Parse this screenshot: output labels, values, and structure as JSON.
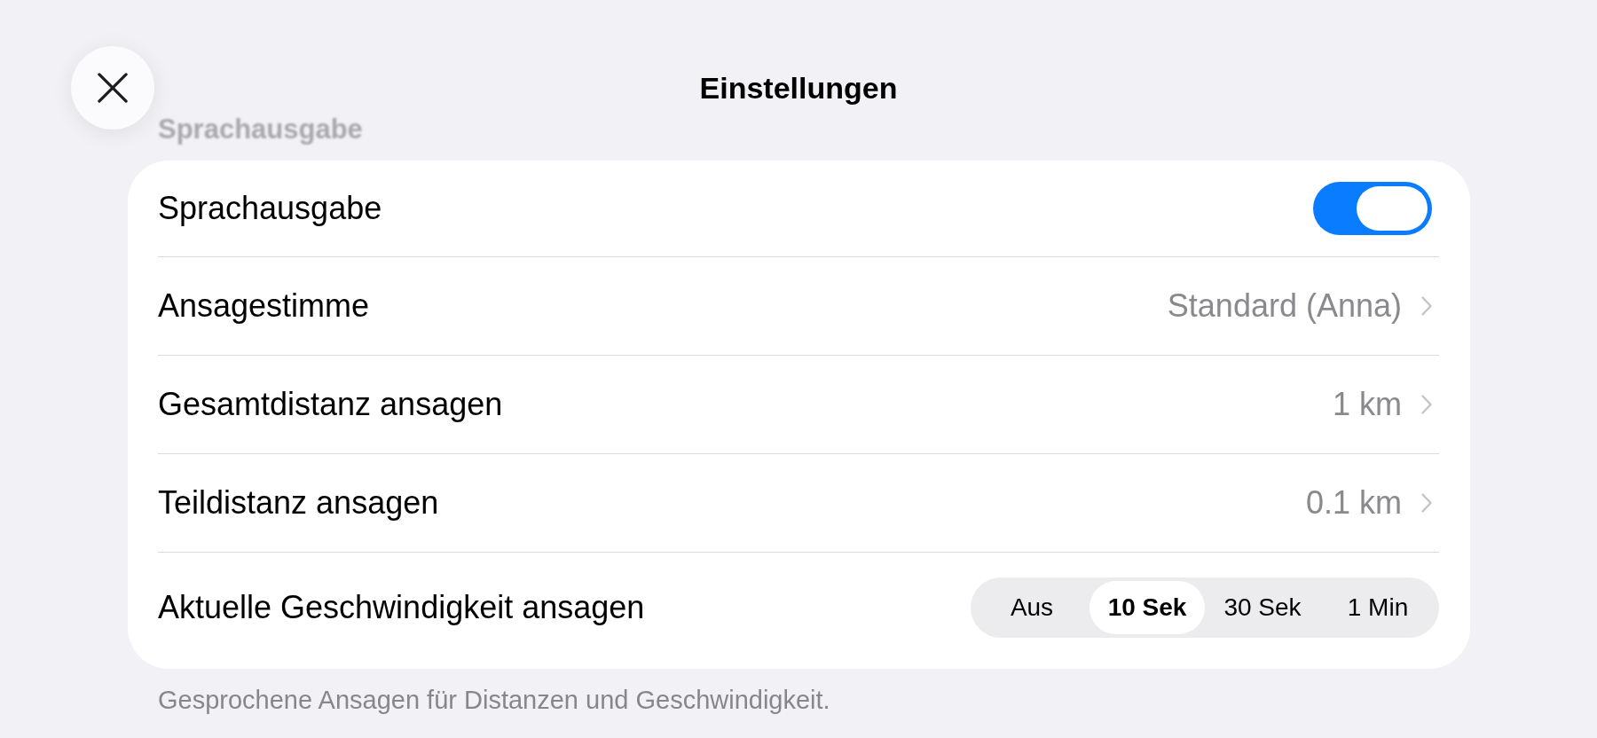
{
  "header": {
    "title": "Einstellungen"
  },
  "section": {
    "title": "Sprachausgabe",
    "footer": "Gesprochene Ansagen für Distanzen und Geschwindigkeit."
  },
  "rows": [
    {
      "kind": "toggle",
      "label": "Sprachausgabe",
      "on": true
    },
    {
      "kind": "link",
      "label": "Ansagestimme",
      "value": "Standard (Anna)"
    },
    {
      "kind": "link",
      "label": "Gesamtdistanz ansagen",
      "value": "1 km"
    },
    {
      "kind": "link",
      "label": "Teildistanz ansagen",
      "value": "0.1 km"
    },
    {
      "kind": "segmented",
      "label": "Aktuelle Geschwindigkeit ansagen",
      "options": [
        {
          "label": "Aus",
          "selected": false
        },
        {
          "label": "10 Sek",
          "selected": true
        },
        {
          "label": "30 Sek",
          "selected": false
        },
        {
          "label": "1 Min",
          "selected": false
        }
      ]
    }
  ]
}
